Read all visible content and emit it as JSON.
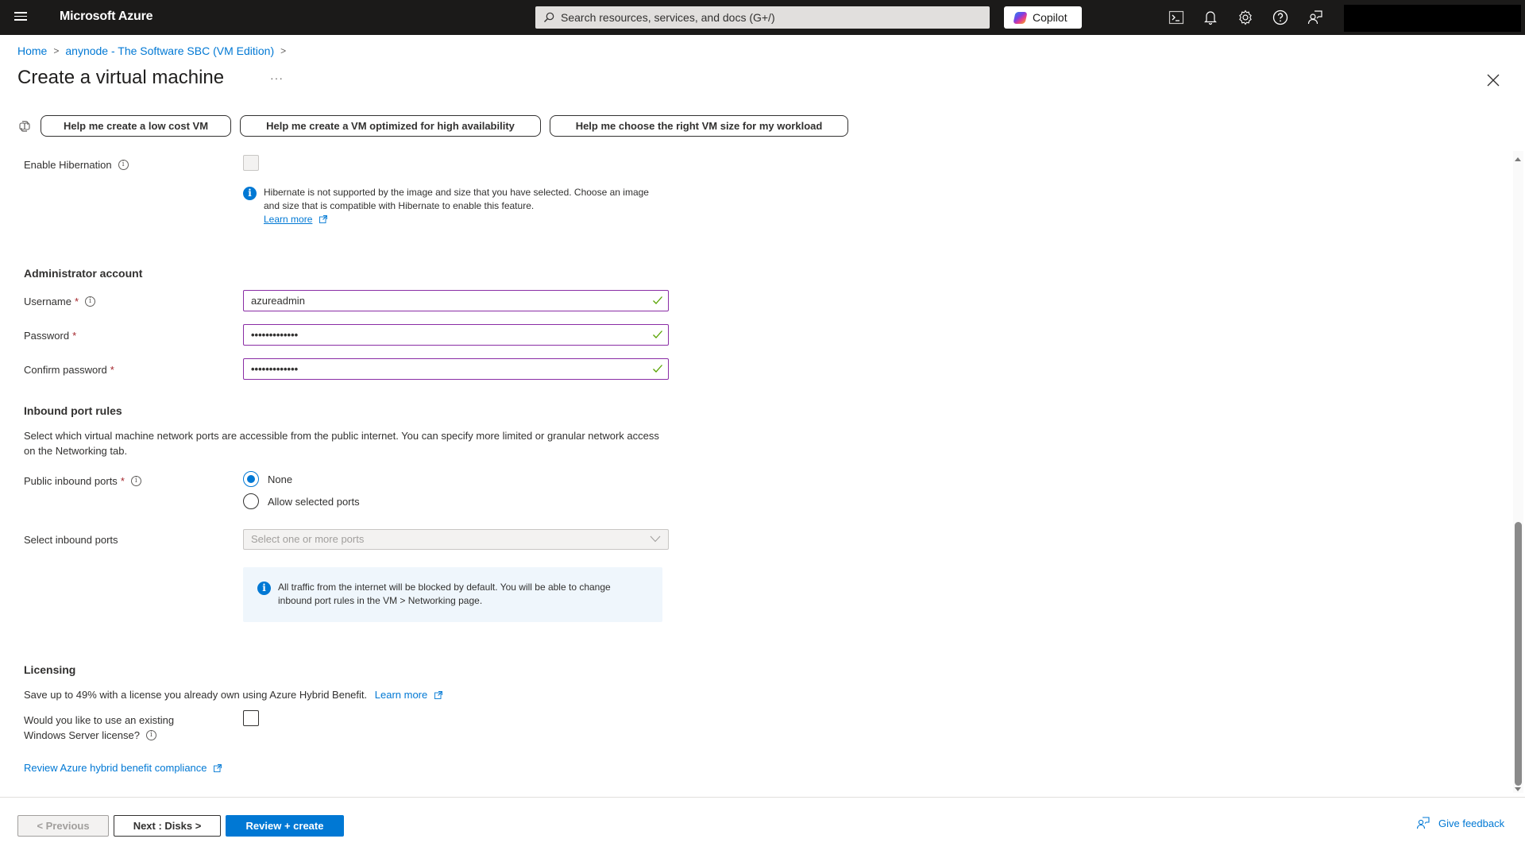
{
  "topbar": {
    "brand": "Microsoft Azure",
    "search_placeholder": "Search resources, services, and docs (G+/)",
    "copilot_label": "Copilot",
    "icons": [
      "menu-icon",
      "cloud-shell-icon",
      "notifications-icon",
      "settings-icon",
      "help-icon",
      "feedback-icon"
    ]
  },
  "breadcrumb": [
    {
      "label": "Home"
    },
    {
      "label": "anynode - The Software SBC (VM Edition)"
    }
  ],
  "page": {
    "title": "Create a virtual machine",
    "more_label": "···"
  },
  "suggestions": [
    "Help me create a low cost VM",
    "Help me create a VM optimized for high availability",
    "Help me choose the right VM size for my workload"
  ],
  "hibernation": {
    "label": "Enable Hibernation",
    "checked": false,
    "disabled": true,
    "note": "Hibernate is not supported by the image and size that you have selected. Choose an image and size that is compatible with Hibernate to enable this feature.",
    "learn_more": "Learn more"
  },
  "admin": {
    "heading": "Administrator account",
    "username_label": "Username",
    "username_value": "azureadmin",
    "password_label": "Password",
    "password_value": "•••••••••••••",
    "confirm_label": "Confirm password",
    "confirm_value": "•••••••••••••",
    "required_mark": "*"
  },
  "inbound": {
    "heading": "Inbound port rules",
    "description": "Select which virtual machine network ports are accessible from the public internet. You can specify more limited or granular network access on the Networking tab.",
    "public_label": "Public inbound ports",
    "options": [
      "None",
      "Allow selected ports"
    ],
    "selected_option": "None",
    "select_label": "Select inbound ports",
    "select_placeholder": "Select one or more ports",
    "info": "All traffic from the internet will be blocked by default. You will be able to change inbound port rules in the VM > Networking page."
  },
  "licensing": {
    "heading": "Licensing",
    "description": "Save up to 49% with a license you already own using Azure Hybrid Benefit.",
    "learn_more": "Learn more",
    "question_line1": "Would you like to use an existing",
    "question_line2": "Windows Server license?",
    "checked": false,
    "compliance_link": "Review Azure hybrid benefit compliance"
  },
  "footer": {
    "previous": "< Previous",
    "next": "Next : Disks >",
    "review": "Review + create",
    "feedback": "Give feedback"
  },
  "colors": {
    "accent": "#0078d4",
    "topbar": "#1b1a19",
    "valid_border": "#8a2da5",
    "valid_check": "#57a300",
    "required": "#a4262c"
  }
}
